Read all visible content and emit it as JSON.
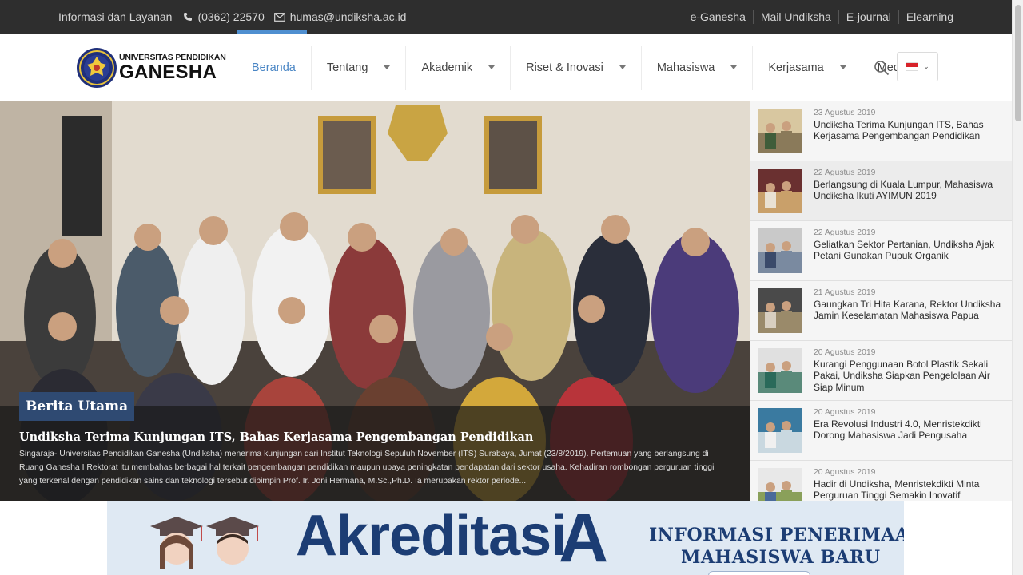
{
  "topbar": {
    "info_label": "Informasi dan Layanan",
    "phone": "(0362) 22570",
    "email": "humas@undiksha.ac.id",
    "links": [
      "e-Ganesha",
      "Mail Undiksha",
      "E-journal",
      "Elearning"
    ]
  },
  "logo": {
    "line1": "UNIVERSITAS PENDIDIKAN",
    "line2": "GANESHA"
  },
  "nav": {
    "items": [
      {
        "label": "Beranda",
        "active": true,
        "dropdown": false
      },
      {
        "label": "Tentang",
        "active": false,
        "dropdown": true
      },
      {
        "label": "Akademik",
        "active": false,
        "dropdown": true
      },
      {
        "label": "Riset & Inovasi",
        "active": false,
        "dropdown": true
      },
      {
        "label": "Mahasiswa",
        "active": false,
        "dropdown": true
      },
      {
        "label": "Kerjasama",
        "active": false,
        "dropdown": true
      },
      {
        "label": "Media",
        "active": false,
        "dropdown": true
      }
    ],
    "search_icon": "search-icon",
    "language_flag": "indonesia-flag"
  },
  "hero": {
    "badge": "Berita Utama",
    "title": "Undiksha Terima Kunjungan ITS, Bahas Kerjasama Pengembangan Pendidikan",
    "description": "Singaraja- Universitas Pendidikan Ganesha (Undiksha) menerima kunjungan dari Institut Teknologi Sepuluh November (ITS) Surabaya, Jumat (23/8/2019). Pertemuan yang berlangsung di Ruang Ganesha I Rektorat itu membahas berbagai hal terkait pengembangan pendidikan maupun upaya peningkatan pendapatan dari sektor usaha. Kehadiran rombongan perguruan tinggi yang terkenal dengan pendidikan sains dan teknologi tersebut dipimpin Prof. Ir. Joni Hermana, M.Sc.,Ph.D. Ia merupakan rektor periode..."
  },
  "news": [
    {
      "date": "23 Agustus 2019",
      "title": "Undiksha Terima Kunjungan ITS, Bahas Kerjasama Pengembangan Pendidikan"
    },
    {
      "date": "22 Agustus 2019",
      "title": "Berlangsung di Kuala Lumpur, Mahasiswa Undiksha Ikuti AYIMUN 2019"
    },
    {
      "date": "22 Agustus 2019",
      "title": "Geliatkan Sektor Pertanian, Undiksha Ajak Petani Gunakan Pupuk Organik"
    },
    {
      "date": "21 Agustus 2019",
      "title": "Gaungkan Tri Hita Karana, Rektor Undiksha Jamin Keselamatan Mahasiswa Papua"
    },
    {
      "date": "20 Agustus 2019",
      "title": "Kurangi Penggunaan Botol Plastik Sekali Pakai, Undiksha Siapkan Pengelolaan Air Siap Minum"
    },
    {
      "date": "20 Agustus 2019",
      "title": "Era Revolusi Industri 4.0, Menristekdikti Dorong Mahasiswa Jadi Pengusaha"
    },
    {
      "date": "20 Agustus 2019",
      "title": "Hadir di Undiksha, Menristekdikti Minta Perguruan Tinggi Semakin Inovatif"
    }
  ],
  "banner": {
    "akreditasi": "Akreditasi",
    "akreditasi_num": "A",
    "pmb_line1": "INFORMASI PENERIMAAN",
    "pmb_line2": "MAHASISWA BARU"
  },
  "colors": {
    "topbar": "#2e2e2e",
    "accent": "#4a86c5",
    "badge": "#2f4a72",
    "banner_text": "#1c3d74"
  }
}
